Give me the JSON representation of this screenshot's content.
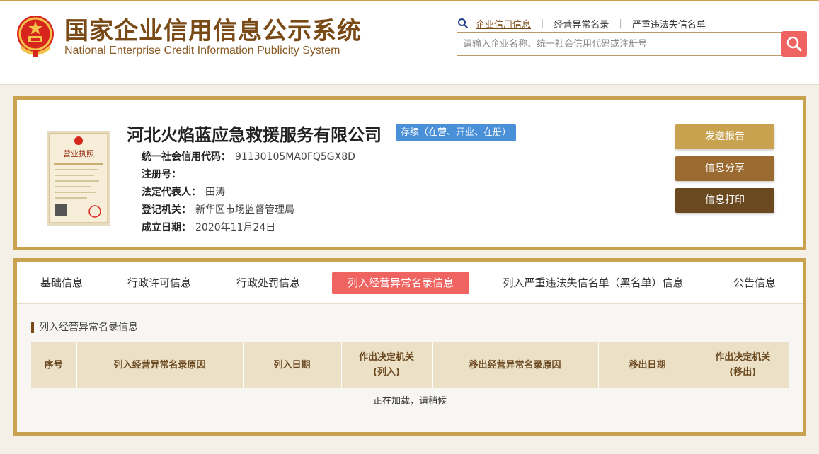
{
  "header": {
    "title_cn": "国家企业信用信息公示系统",
    "title_en": "National Enterprise Credit Information Publicity System",
    "links": [
      "企业信用信息",
      "经营异常名录",
      "严重违法失信名单"
    ],
    "search_placeholder": "请输入企业名称、统一社会信用代码或注册号",
    "search_icon": "search-icon"
  },
  "company": {
    "name": "河北火焰蓝应急救援服务有限公司",
    "status": "存续（在营、开业、在册）",
    "fields": [
      {
        "label": "统一社会信用代码：",
        "value": "91130105MA0FQ5GX8D"
      },
      {
        "label": "注册号：",
        "value": ""
      },
      {
        "label": "法定代表人：",
        "value": "田涛"
      },
      {
        "label": "登记机关：",
        "value": "新华区市场监督管理局"
      },
      {
        "label": "成立日期：",
        "value": "2020年11月24日"
      }
    ],
    "license_label": "营业执照"
  },
  "actions": {
    "send": "发送报告",
    "share": "信息分享",
    "print": "信息打印"
  },
  "tabs": [
    "基础信息",
    "行政许可信息",
    "行政处罚信息",
    "列入经营异常名录信息",
    "列入严重违法失信名单（黑名单）信息",
    "公告信息"
  ],
  "active_tab": 3,
  "section": {
    "title": "列入经营异常名录信息",
    "columns": [
      {
        "line1": "序号",
        "line2": ""
      },
      {
        "line1": "列入经营异常名录原因",
        "line2": ""
      },
      {
        "line1": "列入日期",
        "line2": ""
      },
      {
        "line1": "作出决定机关",
        "line2": "(列入)"
      },
      {
        "line1": "移出经营异常名录原因",
        "line2": ""
      },
      {
        "line1": "移出日期",
        "line2": ""
      },
      {
        "line1": "作出决定机关",
        "line2": "(移出)"
      }
    ],
    "loading": "正在加载，请稍候"
  },
  "colors": {
    "brand_gold": "#c9a250",
    "brand_brown": "#7a4a16",
    "accent_red": "#ef6361",
    "status_blue": "#4a90d9"
  }
}
